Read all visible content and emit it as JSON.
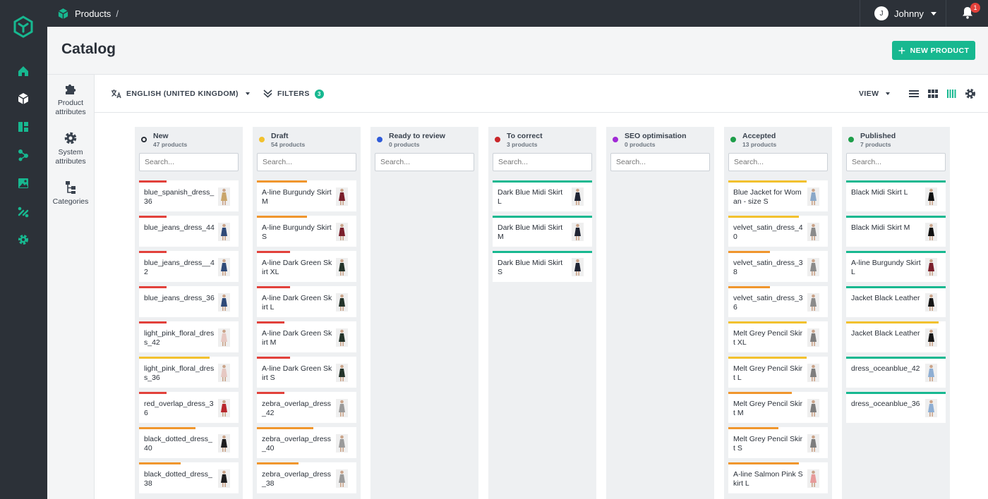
{
  "breadcrumb": {
    "section": "Products",
    "separator": "/"
  },
  "user": {
    "name": "Johnny",
    "initial": "J"
  },
  "notifications": {
    "count": "1"
  },
  "page": {
    "title": "Catalog",
    "new_button": "NEW PRODUCT"
  },
  "sidebar": {
    "items": [
      {
        "label": "Product attributes",
        "icon": "puzzle-icon"
      },
      {
        "label": "System attributes",
        "icon": "gear-icon"
      },
      {
        "label": "Categories",
        "icon": "tree-icon"
      }
    ]
  },
  "rail": {
    "icons": [
      "home-icon",
      "products-icon",
      "dashboard-icon",
      "workflow-icon",
      "media-icon",
      "integrations-icon",
      "settings-icon"
    ]
  },
  "toolbar": {
    "language": "ENGLISH (UNITED KINGDOM)",
    "filters": "FILTERS",
    "filter_count": "3",
    "view": "VIEW"
  },
  "colors": {
    "accent": "#17b890",
    "red": "#e2413b",
    "orange": "#f0962d",
    "yellow": "#f2c12e",
    "green": "#17b890"
  },
  "search_placeholder": "Search...",
  "columns": [
    {
      "name": "New",
      "count": "47 products",
      "dot": "#ffffff",
      "dotBorder": "#2a3039",
      "cards": [
        {
          "label": "blue_spanish_dress_36",
          "status": "red",
          "fill": 0.28,
          "thumb": "#c9a56b"
        },
        {
          "label": "blue_jeans_dress_44",
          "status": "red",
          "fill": 0.28,
          "thumb": "#2f4a78"
        },
        {
          "label": "blue_jeans_dress__42",
          "status": "red",
          "fill": 0.28,
          "thumb": "#2f4a78"
        },
        {
          "label": "blue_jeans_dress_36",
          "status": "red",
          "fill": 0.28,
          "thumb": "#2f4a78"
        },
        {
          "label": "light_pink_floral_dress_42",
          "status": "red",
          "fill": 0.28,
          "thumb": "#e6c8c2"
        },
        {
          "label": "light_pink_floral_dress_36",
          "status": "yellow",
          "fill": 0.71,
          "thumb": "#e6c8c2"
        },
        {
          "label": "red_overlap_dress_36",
          "status": "red",
          "fill": 0.28,
          "thumb": "#b8262c"
        },
        {
          "label": "black_dotted_dress_40",
          "status": "orange",
          "fill": 0.57,
          "thumb": "#1d1d1f"
        },
        {
          "label": "black_dotted_dress_38",
          "status": "orange",
          "fill": 0.42,
          "thumb": "#1d1d1f"
        }
      ]
    },
    {
      "name": "Draft",
      "count": "54 products",
      "dot": "#f2c12e",
      "dotBorder": "#f2c12e",
      "cards": [
        {
          "label": "A-line Burgundy Skirt M",
          "status": "orange",
          "fill": 0.5,
          "thumb": "#7a1f2b"
        },
        {
          "label": "A-line Burgundy Skirt S",
          "status": "orange",
          "fill": 0.5,
          "thumb": "#7a1f2b"
        },
        {
          "label": "A-line Dark Green Skirt XL",
          "status": "red",
          "fill": 0.33,
          "thumb": "#233329"
        },
        {
          "label": "A-line Dark Green Skirt L",
          "status": "red",
          "fill": 0.33,
          "thumb": "#233329"
        },
        {
          "label": "A-line Dark Green Skirt M",
          "status": "red",
          "fill": 0.28,
          "thumb": "#233329"
        },
        {
          "label": "A-line Dark Green Skirt S",
          "status": "red",
          "fill": 0.33,
          "thumb": "#233329"
        },
        {
          "label": "zebra_overlap_dress_42",
          "status": "red",
          "fill": 0.28,
          "thumb": "#9a9a9a"
        },
        {
          "label": "zebra_overlap_dress_40",
          "status": "orange",
          "fill": 0.57,
          "thumb": "#9a9a9a"
        },
        {
          "label": "zebra_overlap_dress_38",
          "status": "orange",
          "fill": 0.42,
          "thumb": "#9a9a9a"
        }
      ]
    },
    {
      "name": "Ready to review",
      "count": "0 products",
      "dot": "#2f5bd9",
      "dotBorder": "#2f5bd9",
      "cards": []
    },
    {
      "name": "To correct",
      "count": "3 products",
      "dot": "#c9272b",
      "dotBorder": "#c9272b",
      "cards": [
        {
          "label": "Dark Blue Midi Skirt L",
          "status": "green",
          "fill": 1,
          "thumb": "#1f2433"
        },
        {
          "label": "Dark Blue Midi Skirt M",
          "status": "green",
          "fill": 1,
          "thumb": "#1f2433"
        },
        {
          "label": "Dark Blue Midi Skirt S",
          "status": "green",
          "fill": 1,
          "thumb": "#1f2433"
        }
      ]
    },
    {
      "name": "SEO optimisation",
      "count": "0 products",
      "dot": "#a12ad6",
      "dotBorder": "#a12ad6",
      "cards": []
    },
    {
      "name": "Accepted",
      "count": "13 products",
      "dot": "#1e9e4a",
      "dotBorder": "#1e9e4a",
      "cards": [
        {
          "label": "Blue Jacket for Woman - size S",
          "status": "yellow",
          "fill": 0.79,
          "thumb": "#8aa8c8"
        },
        {
          "label": "velvet_satin_dress_40",
          "status": "yellow",
          "fill": 0.71,
          "thumb": "#8a8a8a"
        },
        {
          "label": "velvet_satin_dress_38",
          "status": "orange",
          "fill": 0.42,
          "thumb": "#8a8a8a"
        },
        {
          "label": "velvet_satin_dress_36",
          "status": "orange",
          "fill": 0.42,
          "thumb": "#8a8a8a"
        },
        {
          "label": "Melt Grey Pencil Skirt XL",
          "status": "yellow",
          "fill": 0.79,
          "thumb": "#7d7d7d"
        },
        {
          "label": "Melt Grey Pencil Skirt L",
          "status": "yellow",
          "fill": 0.79,
          "thumb": "#7d7d7d"
        },
        {
          "label": "Melt Grey Pencil Skirt M",
          "status": "orange",
          "fill": 0.64,
          "thumb": "#7d7d7d"
        },
        {
          "label": "Melt Grey Pencil Skirt S",
          "status": "orange",
          "fill": 0.5,
          "thumb": "#7d7d7d"
        },
        {
          "label": "A-line Salmon Pink Skirt L",
          "status": "orange",
          "fill": 0.71,
          "thumb": "#e79a9a"
        }
      ]
    },
    {
      "name": "Published",
      "count": "7 products",
      "dot": "#1e9e4a",
      "dotBorder": "#1e9e4a",
      "cards": [
        {
          "label": "Black Midi Skirt L",
          "status": "green",
          "fill": 1,
          "thumb": "#111111"
        },
        {
          "label": "Black Midi Skirt M",
          "status": "green",
          "fill": 1,
          "thumb": "#111111"
        },
        {
          "label": "A-line Burgundy Skirt L",
          "status": "green",
          "fill": 1,
          "thumb": "#7a1f2b"
        },
        {
          "label": "Jacket Black Leather",
          "status": "green",
          "fill": 1,
          "thumb": "#161616"
        },
        {
          "label": "Jacket Black Leather",
          "status": "yellow",
          "fill": 0.93,
          "thumb": "#161616"
        },
        {
          "label": "dress_oceanblue_42",
          "status": "green",
          "fill": 1,
          "thumb": "#8eaed3"
        },
        {
          "label": "dress_oceanblue_36",
          "status": "green",
          "fill": 1,
          "thumb": "#8eaed3"
        }
      ]
    }
  ]
}
